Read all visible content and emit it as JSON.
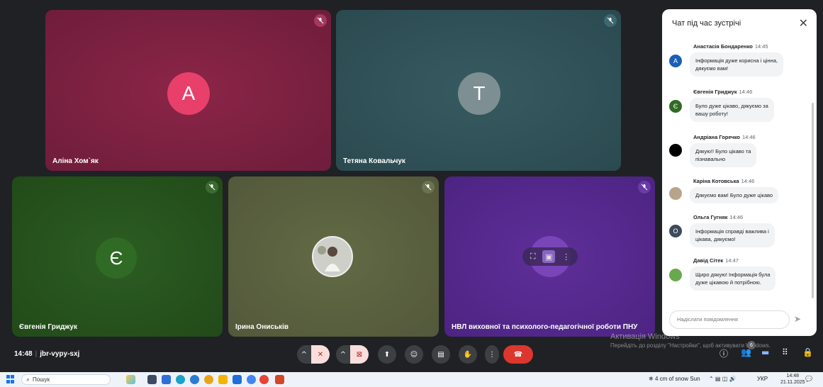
{
  "tiles": [
    {
      "name": "Аліна Хом`як",
      "initial": "A"
    },
    {
      "name": "Тетяна Ковальчук",
      "initial": "T"
    },
    {
      "name": "Євгенія Гриджук",
      "initial": "Є"
    },
    {
      "name": "Ірина Ониськів",
      "initial": ""
    },
    {
      "name": "НВЛ виховної та психолого-педагогічної роботи ПНУ",
      "initial": ""
    }
  ],
  "chat": {
    "title": "Чат під час зустрічі",
    "input_placeholder": "Надіслати повідомлення",
    "messages": [
      {
        "author": "Анастасія Бондаренко",
        "time": "14:45",
        "line1": "Інформація дуже корисна і цінна,",
        "line2": "дякуємо вам!",
        "avatar": "A",
        "avatar_color": "#1a5fb4"
      },
      {
        "author": "Євгенія Гриджук",
        "time": "14:46",
        "line1": "Було дуже цікаво, дякуємо за",
        "line2": "вашу роботу!",
        "avatar": "Є",
        "avatar_color": "#2f6b25"
      },
      {
        "author": "Андріана Горечко",
        "time": "14:46",
        "line1": "Дякую!! Було цікаво та",
        "line2": "пізнавально",
        "avatar": "",
        "avatar_color": "#000000"
      },
      {
        "author": "Каріна Котовська",
        "time": "14:46",
        "line1": "Дякуємо вам! Було дуже цікаво",
        "line2": "",
        "avatar": "",
        "avatar_color": "#b8a48a"
      },
      {
        "author": "Ольга Гугняк",
        "time": "14:46",
        "line1": "Інформація справді важлива і",
        "line2": "цікава, дякуємо!",
        "avatar": "О",
        "avatar_color": "#3c4a5a"
      },
      {
        "author": "Давід Сітек",
        "time": "14:47",
        "line1": "Щиро дякую! Інформація була",
        "line2": "дуже цікавою й потрібною.",
        "avatar": "",
        "avatar_color": "#6aa84f"
      }
    ]
  },
  "meeting": {
    "time": "14:48",
    "code": "jbr-vypy-sxj",
    "participants_badge": "6"
  },
  "watermark": {
    "line1": "Активація Windows",
    "line2": "Перейдіть до розділу \"Настройки\", щоб активувати Windows."
  },
  "taskbar": {
    "search_label": "Пошук",
    "weather": "4 cm of snow Sun",
    "lang": "УКР",
    "time": "14:48",
    "date": "21.11.2025"
  }
}
